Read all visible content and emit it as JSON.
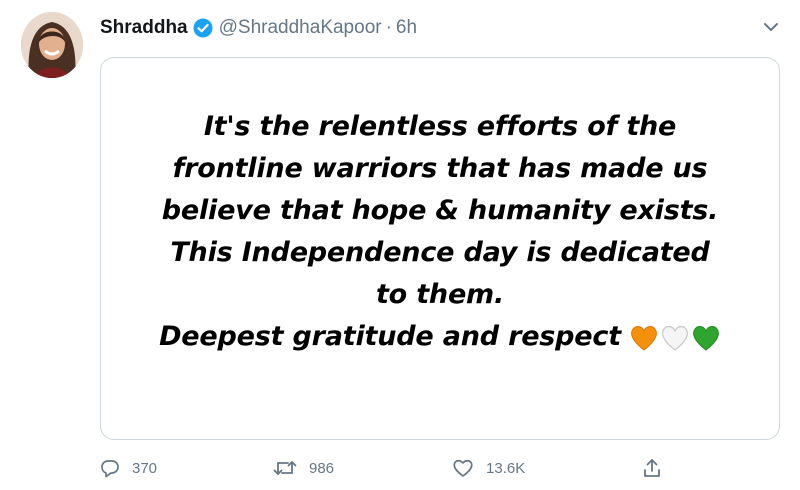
{
  "author": {
    "display_name": "Shraddha",
    "handle": "@ShraddhaKapoor",
    "separator": "·",
    "time": "6h",
    "verified": true,
    "avatar_icon": "profile-photo"
  },
  "media": {
    "lines": [
      "It's the relentless efforts of the",
      "frontline warriors that has made us",
      "believe that hope & humanity exists.",
      "This Independence day is dedicated",
      "to them.",
      "Deepest gratitude and respect"
    ],
    "hearts": [
      {
        "icon": "orange-heart-icon",
        "color": "#f4900c"
      },
      {
        "icon": "white-heart-icon",
        "color": "#ffffff"
      },
      {
        "icon": "green-heart-icon",
        "color": "#2fa52f"
      }
    ]
  },
  "actions": {
    "reply": {
      "icon": "reply-icon",
      "count": "370"
    },
    "retweet": {
      "icon": "retweet-icon",
      "count": "986"
    },
    "like": {
      "icon": "like-icon",
      "count": "13.6K"
    },
    "share": {
      "icon": "share-icon"
    }
  },
  "colors": {
    "verified": "#1da1f2",
    "muted": "#657786",
    "border": "#ccd6dd",
    "text": "#14171a"
  }
}
